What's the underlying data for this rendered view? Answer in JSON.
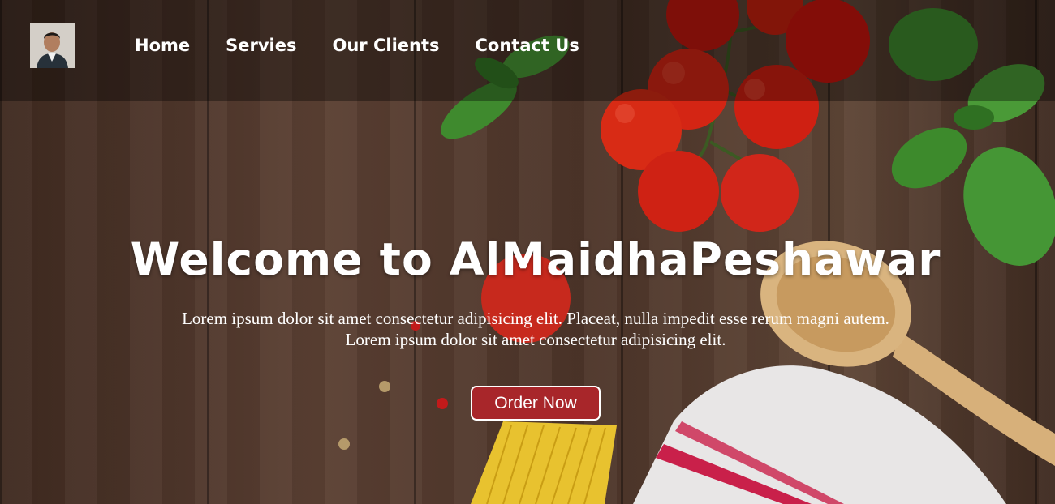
{
  "nav": {
    "logo_alt": "profile photo",
    "links": [
      {
        "label": "Home"
      },
      {
        "label": "Servies"
      },
      {
        "label": "Our Clients"
      },
      {
        "label": "Contact Us"
      }
    ]
  },
  "hero": {
    "title": "Welcome to AlMaidhaPeshawar",
    "line1": "Lorem ipsum dolor sit amet consectetur adipisicing elit. Placeat, nulla impedit esse rerum magni autem.",
    "line2": "Lorem ipsum dolor sit amet consectetur adipisicing elit.",
    "button_label": "Order Now"
  },
  "colors": {
    "button_bg": "#a8262a",
    "nav_overlay": "rgba(0,0,0,0.35)",
    "text": "#ffffff"
  }
}
